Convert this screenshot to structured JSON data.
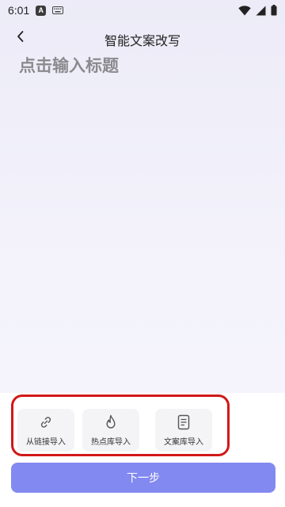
{
  "status_bar": {
    "time": "6:01",
    "notification_icons": [
      "a-icon",
      "keyboard-icon"
    ],
    "system_icons": [
      "wifi-icon",
      "signal-icon",
      "battery-icon"
    ]
  },
  "header": {
    "title": "智能文案改写",
    "back_icon": "chevron-left-icon"
  },
  "editor": {
    "title_placeholder": "点击输入标题",
    "title_value": "",
    "body_value": ""
  },
  "import_options": [
    {
      "icon": "link-icon",
      "label": "从链接导入"
    },
    {
      "icon": "flame-icon",
      "label": "热点库导入"
    },
    {
      "icon": "document-icon",
      "label": "文案库导入"
    }
  ],
  "next_button": {
    "label": "下一步"
  },
  "colors": {
    "accent": "#8289f0",
    "highlight": "#d11818",
    "background": "#f1f0fa",
    "card": "#f4f4f6"
  }
}
